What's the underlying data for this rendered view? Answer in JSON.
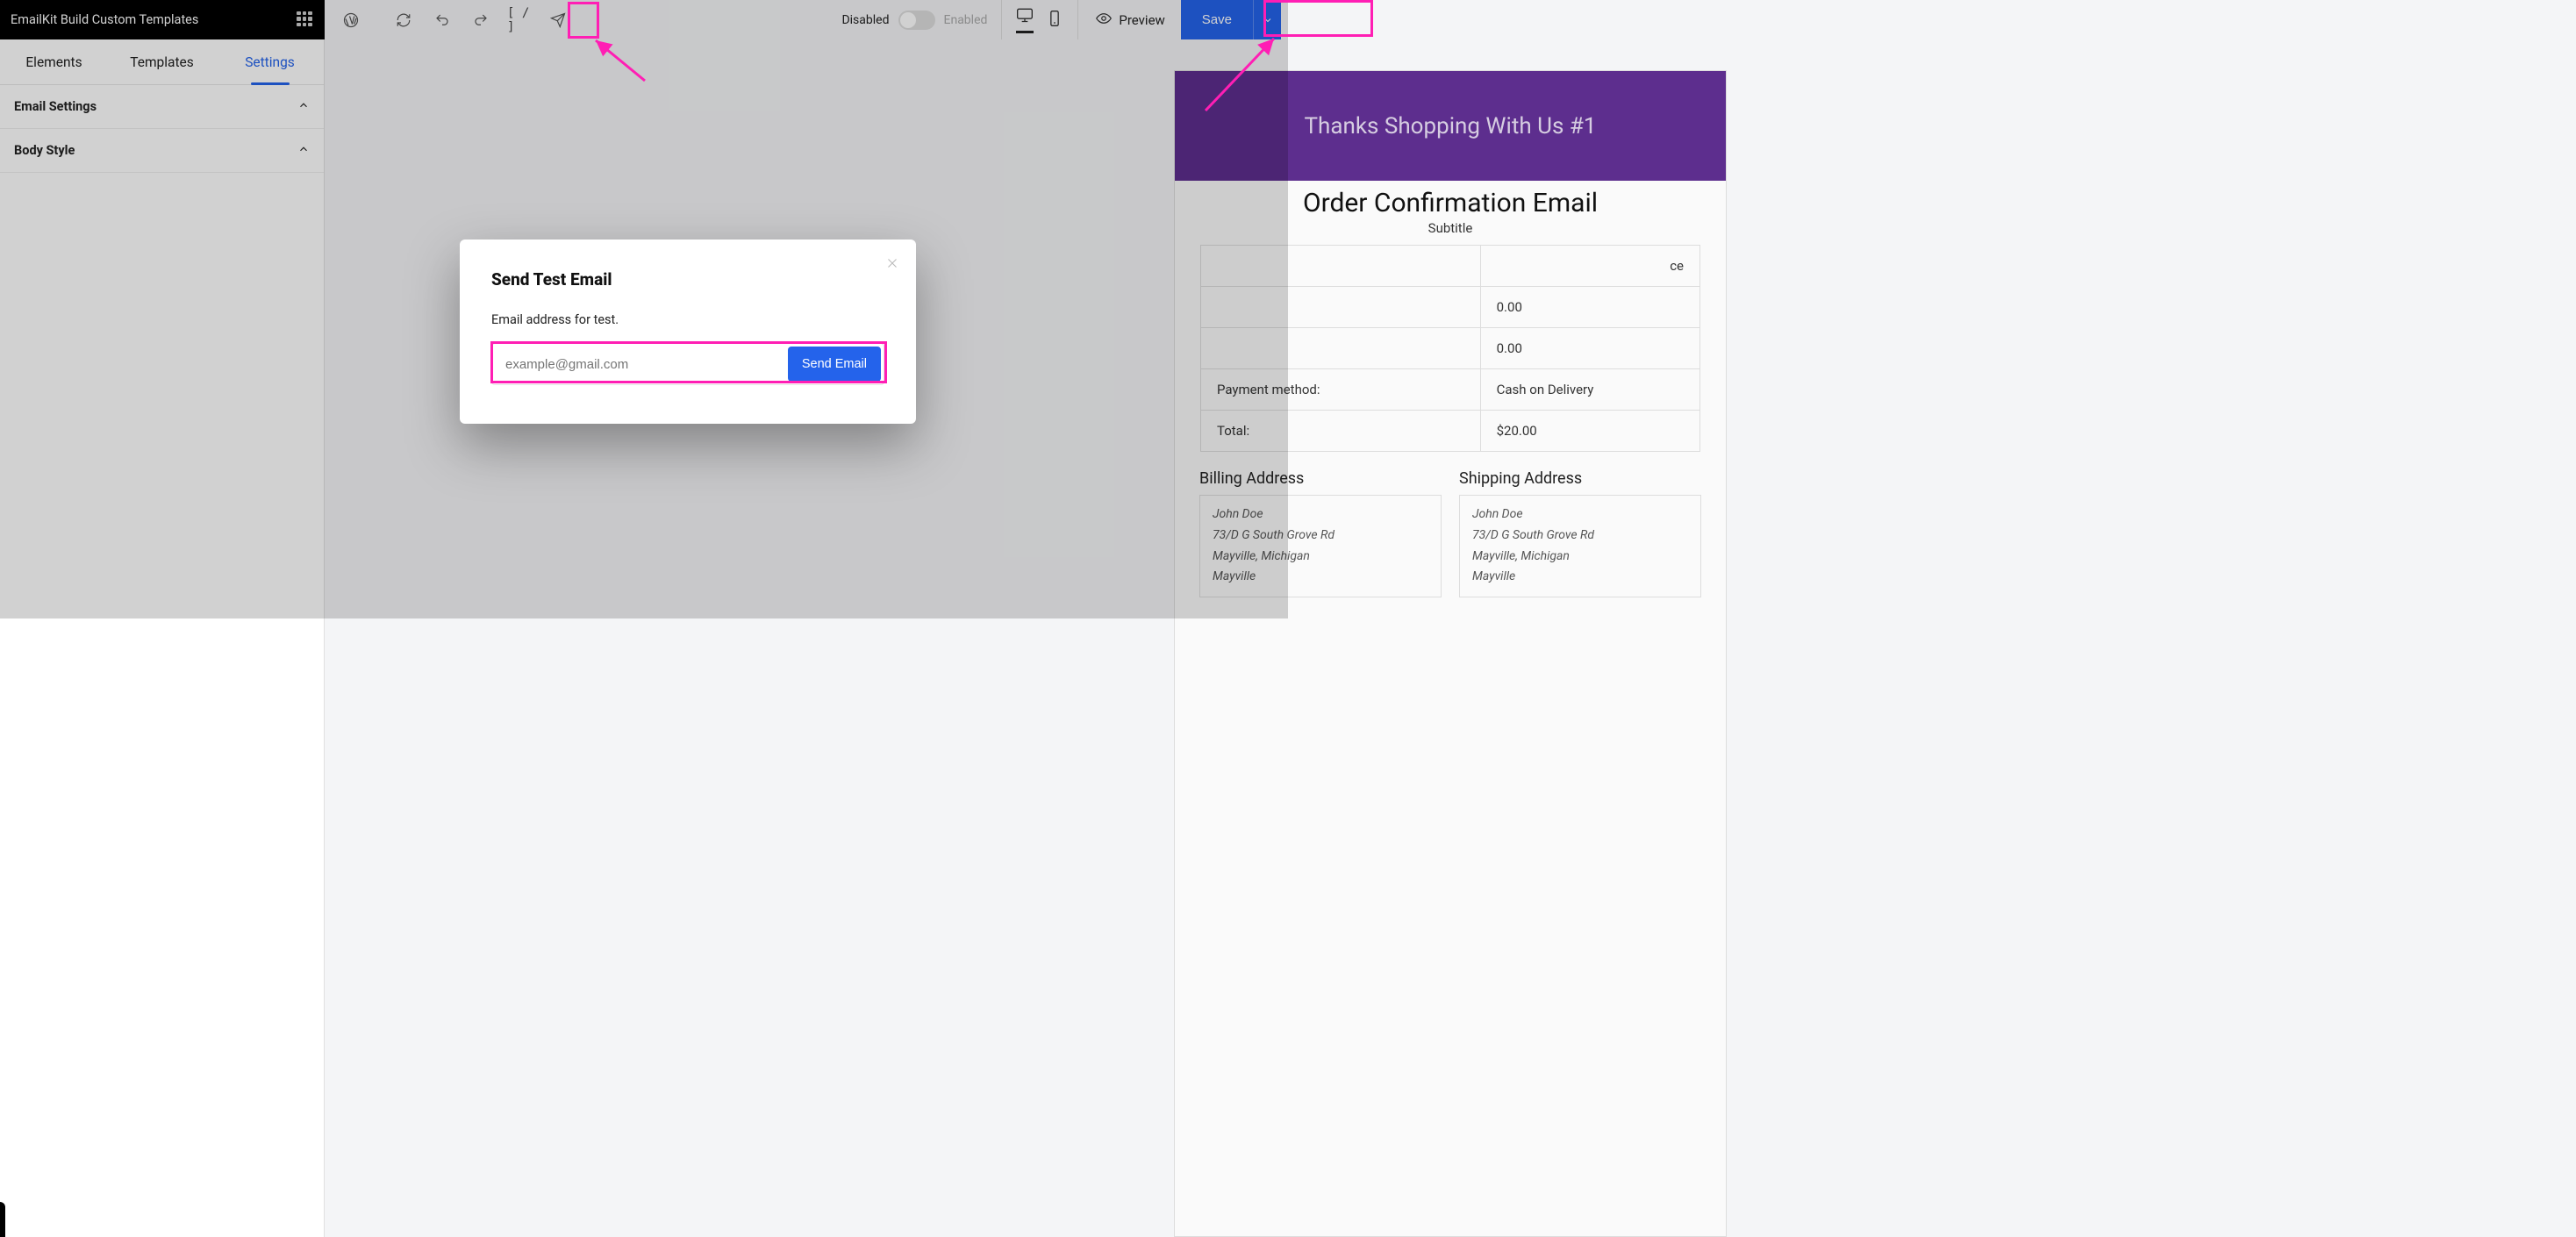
{
  "brand": {
    "title": "EmailKit Build Custom Templates"
  },
  "toolbar": {
    "shortcode": "[ / ]",
    "toggle_off": "Disabled",
    "toggle_on": "Enabled",
    "preview": "Preview",
    "save": "Save"
  },
  "sidebar": {
    "tabs": [
      "Elements",
      "Templates",
      "Settings"
    ],
    "active_tab_index": 2,
    "sections": {
      "email_settings": "Email Settings",
      "body_style": "Body Style"
    }
  },
  "email": {
    "banner": "Thanks Shopping With Us #1",
    "title": "Order Confirmation Email",
    "subtitle": "Subtitle",
    "table": {
      "rows": [
        {
          "label": "",
          "value": "ce"
        },
        {
          "label": "",
          "value": "0.00"
        },
        {
          "label": "",
          "value": "0.00"
        },
        {
          "label": "Payment method:",
          "value": "Cash on Delivery"
        },
        {
          "label": "Total:",
          "value": "$20.00"
        }
      ]
    },
    "billing_title": "Billing Address",
    "shipping_title": "Shipping Address",
    "address": {
      "name": "John Doe",
      "line1": "73/D G South Grove Rd",
      "line2": "Mayville, Michigan",
      "line3": "Mayville"
    }
  },
  "modal": {
    "title": "Send Test Email",
    "label": "Email address for test.",
    "placeholder": "example@gmail.com",
    "send": "Send Email"
  }
}
